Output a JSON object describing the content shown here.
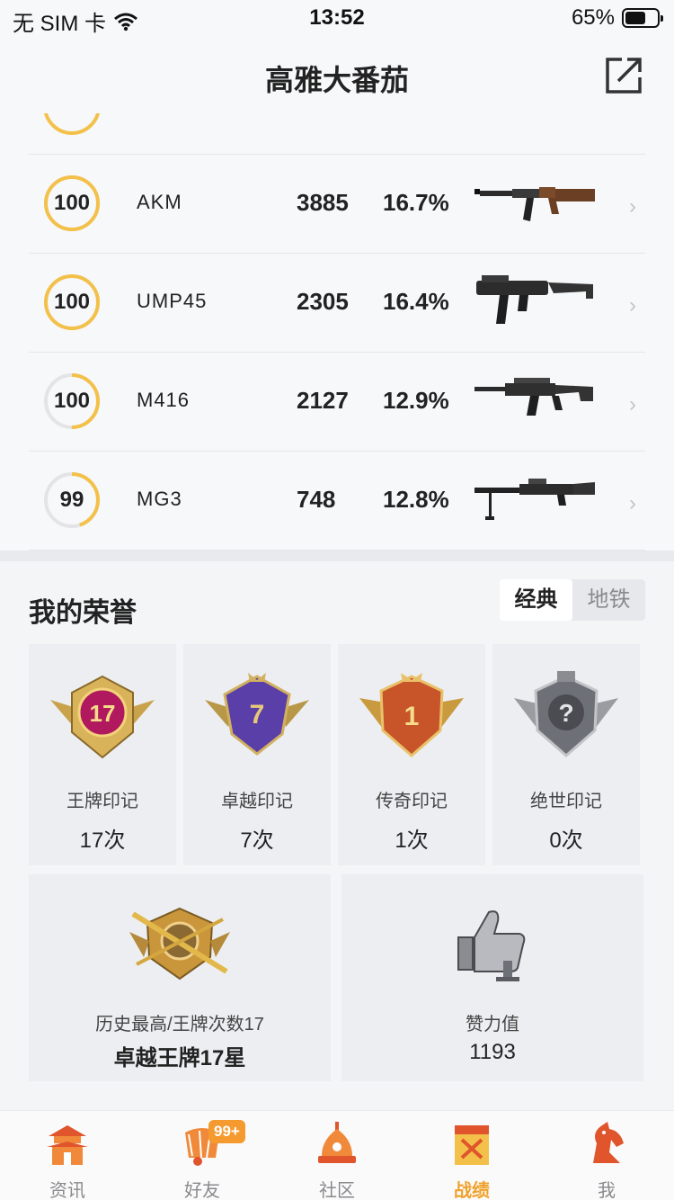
{
  "status_bar": {
    "carrier": "无 SIM 卡",
    "time": "13:52",
    "battery_pct_text": "65%",
    "battery_level": 0.65
  },
  "header": {
    "title": "高雅大番茄",
    "share_icon": "share-external-icon"
  },
  "weapons": [
    {
      "level": "100",
      "progress": 1.0,
      "name": "AKM",
      "kills": "3885",
      "pct": "16.7%",
      "gun": "akm"
    },
    {
      "level": "100",
      "progress": 1.0,
      "name": "UMP45",
      "kills": "2305",
      "pct": "16.4%",
      "gun": "ump45"
    },
    {
      "level": "100",
      "progress": 0.5,
      "name": "M416",
      "kills": "2127",
      "pct": "12.9%",
      "gun": "m416"
    },
    {
      "level": "99",
      "progress": 0.45,
      "name": "MG3",
      "kills": "748",
      "pct": "12.8%",
      "gun": "mg3"
    }
  ],
  "honor": {
    "title": "我的荣誉",
    "segments": [
      {
        "label": "经典",
        "active": true
      },
      {
        "label": "地铁",
        "active": false
      }
    ],
    "marks": [
      {
        "label": "王牌印记",
        "count": "17次",
        "badge_num": "17",
        "color": "#b0195e"
      },
      {
        "label": "卓越印记",
        "count": "7次",
        "badge_num": "7",
        "color": "#5b3fa8"
      },
      {
        "label": "传奇印记",
        "count": "1次",
        "badge_num": "1",
        "color": "#c8552a"
      },
      {
        "label": "绝世印记",
        "count": "0次",
        "badge_num": "?",
        "color": "#777a80"
      }
    ],
    "history": {
      "label": "历史最高/王牌次数17",
      "value": "卓越王牌17星"
    },
    "likes": {
      "label": "赞力值",
      "value": "1193"
    }
  },
  "tabbar": {
    "tabs": [
      {
        "label": "资讯",
        "icon": "pagoda-icon",
        "active": false
      },
      {
        "label": "好友",
        "icon": "friends-icon",
        "active": false,
        "badge": "99+"
      },
      {
        "label": "社区",
        "icon": "community-icon",
        "active": false
      },
      {
        "label": "战绩",
        "icon": "record-icon",
        "active": true
      },
      {
        "label": "我",
        "icon": "horse-icon",
        "active": false
      }
    ]
  },
  "colors": {
    "accent": "#f0a12a",
    "ring": "#f3c14a",
    "badge": "#f59a2e"
  }
}
